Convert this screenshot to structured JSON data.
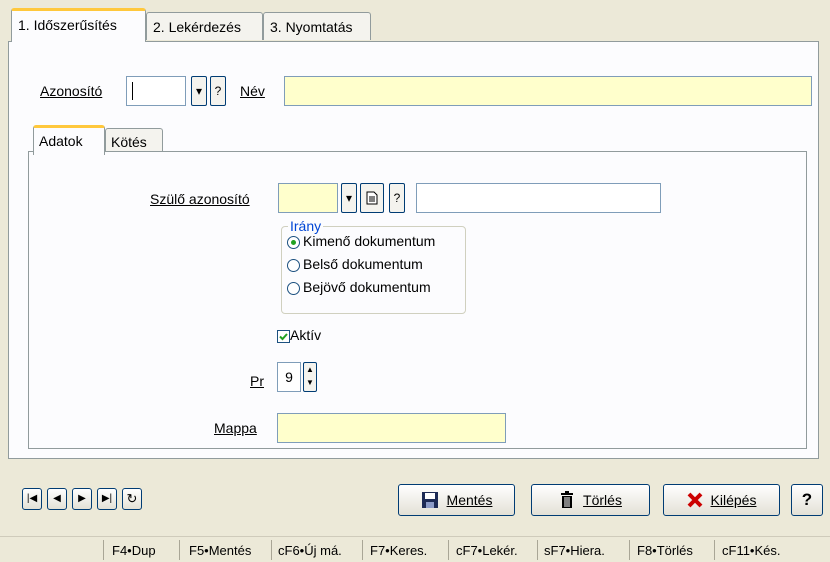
{
  "tabs": [
    {
      "label": "1. Időszerűsítés"
    },
    {
      "label": "2. Lekérdezés"
    },
    {
      "label": "3. Nyomtatás"
    }
  ],
  "form": {
    "azonosito_label": "Azonosító",
    "azonosito_value": "",
    "lookup_q": "?",
    "nev_label": "Név",
    "nev_value": ""
  },
  "inner_tabs": [
    {
      "label": "Adatok"
    },
    {
      "label": "Kötés"
    }
  ],
  "adatok": {
    "szulo_label": "Szülő azonosító",
    "szulo_value": "",
    "szulo_q": "?",
    "szulo_name_value": "",
    "irany_label": "Irány",
    "irany_options": [
      {
        "label": "Kimenő dokumentum"
      },
      {
        "label": "Belső dokumentum"
      },
      {
        "label": "Bejövő dokumentum"
      }
    ],
    "irany_selected": "Kimenő dokumentum",
    "aktiv_label": "Aktív",
    "aktiv_checked": true,
    "pr_label": "Pr",
    "pr_value": "9",
    "mappa_label": "Mappa",
    "mappa_value": ""
  },
  "buttons": {
    "mentes": "Mentés",
    "torles": "Törlés",
    "kilepes": "Kilépés",
    "help": "?"
  },
  "status_keys": [
    "F4•Dup",
    "F5•Mentés",
    "cF6•Új má.",
    "F7•Keres.",
    "cF7•Lekér.",
    "sF7•Hiera.",
    "F8•Törlés",
    "cF11•Kés."
  ],
  "colors": {
    "accent_tab": "#ffc83c",
    "input_yellow": "#ffffcc",
    "exit_red": "#cc0000"
  }
}
